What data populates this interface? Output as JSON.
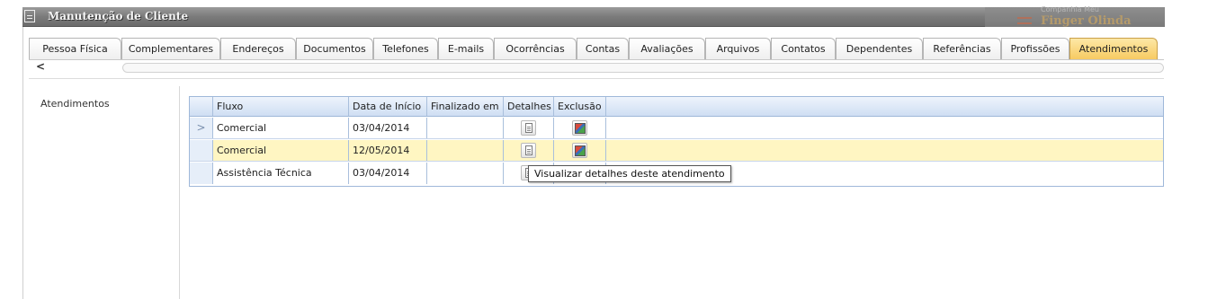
{
  "window": {
    "title": "Manutenção de Cliente",
    "brand_small": "Companhia Meu",
    "brand_name": "Finger Olinda"
  },
  "tabs": [
    {
      "label": "Pessoa Física",
      "active": false
    },
    {
      "label": "Complementares",
      "active": false
    },
    {
      "label": "Endereços",
      "active": false
    },
    {
      "label": "Documentos",
      "active": false
    },
    {
      "label": "Telefones",
      "active": false
    },
    {
      "label": "E-mails",
      "active": false
    },
    {
      "label": "Ocorrências",
      "active": false
    },
    {
      "label": "Contas",
      "active": false
    },
    {
      "label": "Avaliações",
      "active": false
    },
    {
      "label": "Arquivos",
      "active": false
    },
    {
      "label": "Contatos",
      "active": false
    },
    {
      "label": "Dependentes",
      "active": false
    },
    {
      "label": "Referências",
      "active": false
    },
    {
      "label": "Profissões",
      "active": false
    },
    {
      "label": "Atendimentos",
      "active": true
    }
  ],
  "scroll": {
    "left_arrow": "<"
  },
  "section": {
    "label": "Atendimentos"
  },
  "grid": {
    "headers": {
      "fluxo": "Fluxo",
      "data_inicio": "Data de Início",
      "finalizado_em": "Finalizado em",
      "detalhes": "Detalhes",
      "exclusao": "Exclusão"
    },
    "rows": [
      {
        "fluxo": "Comercial",
        "data_inicio": "03/04/2014",
        "finalizado_em": "",
        "current": true,
        "selected": false,
        "indicator": ">"
      },
      {
        "fluxo": "Comercial",
        "data_inicio": "12/05/2014",
        "finalizado_em": "",
        "current": false,
        "selected": true,
        "indicator": ""
      },
      {
        "fluxo": "Assistência Técnica",
        "data_inicio": "03/04/2014",
        "finalizado_em": "",
        "current": false,
        "selected": false,
        "indicator": ""
      }
    ]
  },
  "tooltip": {
    "text": "Visualizar detalhes deste atendimento"
  },
  "colors": {
    "active_tab": "#f7c95f",
    "selected_row": "#fff6c2",
    "grid_header": "#cfdef3"
  }
}
